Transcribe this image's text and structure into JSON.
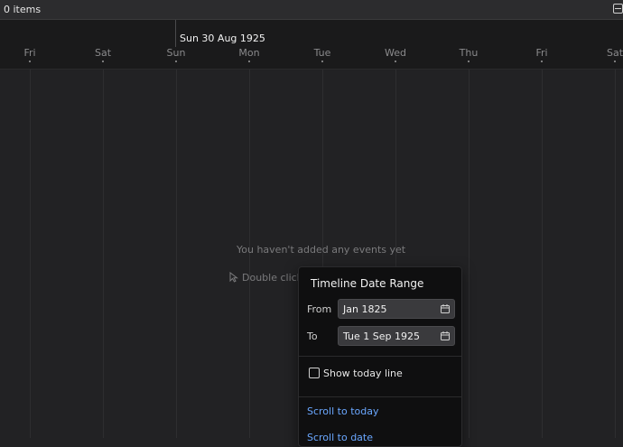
{
  "topbar": {
    "items_count": "0 items",
    "panel_icon": "panel-toggle-icon"
  },
  "timeline": {
    "month_label": "Sun 30 Aug 1925",
    "days": [
      {
        "label": "Fri"
      },
      {
        "label": "Sat"
      },
      {
        "label": "Sun"
      },
      {
        "label": "Mon"
      },
      {
        "label": "Tue"
      },
      {
        "label": "Wed"
      },
      {
        "label": "Thu"
      },
      {
        "label": "Fri"
      },
      {
        "label": "Sat"
      }
    ]
  },
  "empty_state": {
    "title": "You haven't added any events yet",
    "hint": "Double click",
    "hint_icon": "cursor-icon"
  },
  "date_range_popover": {
    "title": "Timeline Date Range",
    "from_label": "From",
    "from_value": "Jan 1825",
    "to_label": "To",
    "to_value": "Tue 1 Sep 1925",
    "show_today_label": "Show today line",
    "show_today_checked": false,
    "scroll_to_today": "Scroll to today",
    "scroll_to_date": "Scroll to date",
    "accent_color": "#6aa7ff"
  }
}
